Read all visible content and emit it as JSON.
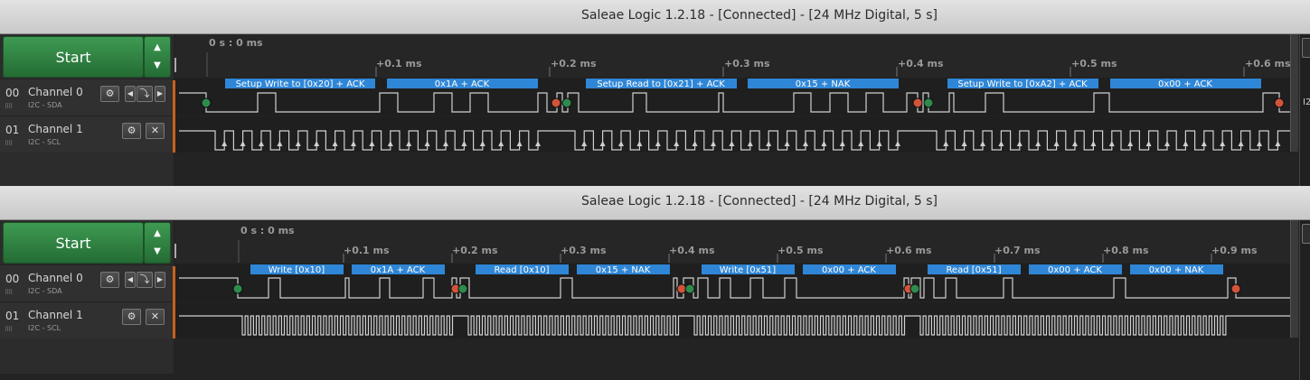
{
  "windows": [
    {
      "title": "Saleae Logic 1.2.18 - [Connected] - [24 MHz Digital, 5 s]",
      "start_label": "Start",
      "time_origin": "0 s : 0 ms",
      "ticks": [
        "+0.1 ms",
        "+0.2 ms",
        "+0.3 ms",
        "+0.4 ms",
        "+0.5 ms",
        "+0.6 ms"
      ],
      "channels": [
        {
          "num": "00",
          "name": "Channel 0",
          "sub": "I2C - SDA",
          "controls": [
            "gear",
            "left",
            "edge",
            "right"
          ]
        },
        {
          "num": "01",
          "name": "Channel 1",
          "sub": "I2C - SCL",
          "controls": [
            "gear",
            "close"
          ]
        }
      ],
      "annotations": [
        "Setup Write to [0x20] + ACK",
        "0x1A + ACK",
        "Setup Read to [0x21] + ACK",
        "0x15 + NAK",
        "Setup Write to [0xA2] + ACK",
        "0x00 + ACK"
      ],
      "edge_label": "I2"
    },
    {
      "title": "Saleae Logic 1.2.18 - [Connected] - [24 MHz Digital, 5 s]",
      "start_label": "Start",
      "time_origin": "0 s : 0 ms",
      "ticks": [
        "+0.1 ms",
        "+0.2 ms",
        "+0.3 ms",
        "+0.4 ms",
        "+0.5 ms",
        "+0.6 ms",
        "+0.7 ms",
        "+0.8 ms",
        "+0.9 ms"
      ],
      "channels": [
        {
          "num": "00",
          "name": "Channel 0",
          "sub": "I2C - SDA",
          "controls": [
            "gear",
            "left",
            "edge",
            "right"
          ]
        },
        {
          "num": "01",
          "name": "Channel 1",
          "sub": "I2C - SCL",
          "controls": [
            "gear",
            "close"
          ]
        }
      ],
      "annotations": [
        "Write [0x10]",
        "0x1A + ACK",
        "Read [0x10]",
        "0x15 + NAK",
        "Write [0x51]",
        "0x00 + ACK",
        "Read [0x51]",
        "0x00 + ACK",
        "0x00 + NAK"
      ]
    }
  ],
  "colors": {
    "start_green": "#2f8a45",
    "annotation_blue": "#2f86d6",
    "start_marker": "#2e8b4e",
    "stop_marker": "#d2533a",
    "trigger_bar": "#c8621e"
  },
  "icons": {
    "gear": "gear-icon",
    "left": "left-arrow-icon",
    "edge": "edge-trigger-icon",
    "right": "right-arrow-icon",
    "close": "close-icon",
    "up": "up-arrow-icon",
    "down": "down-arrow-icon"
  }
}
